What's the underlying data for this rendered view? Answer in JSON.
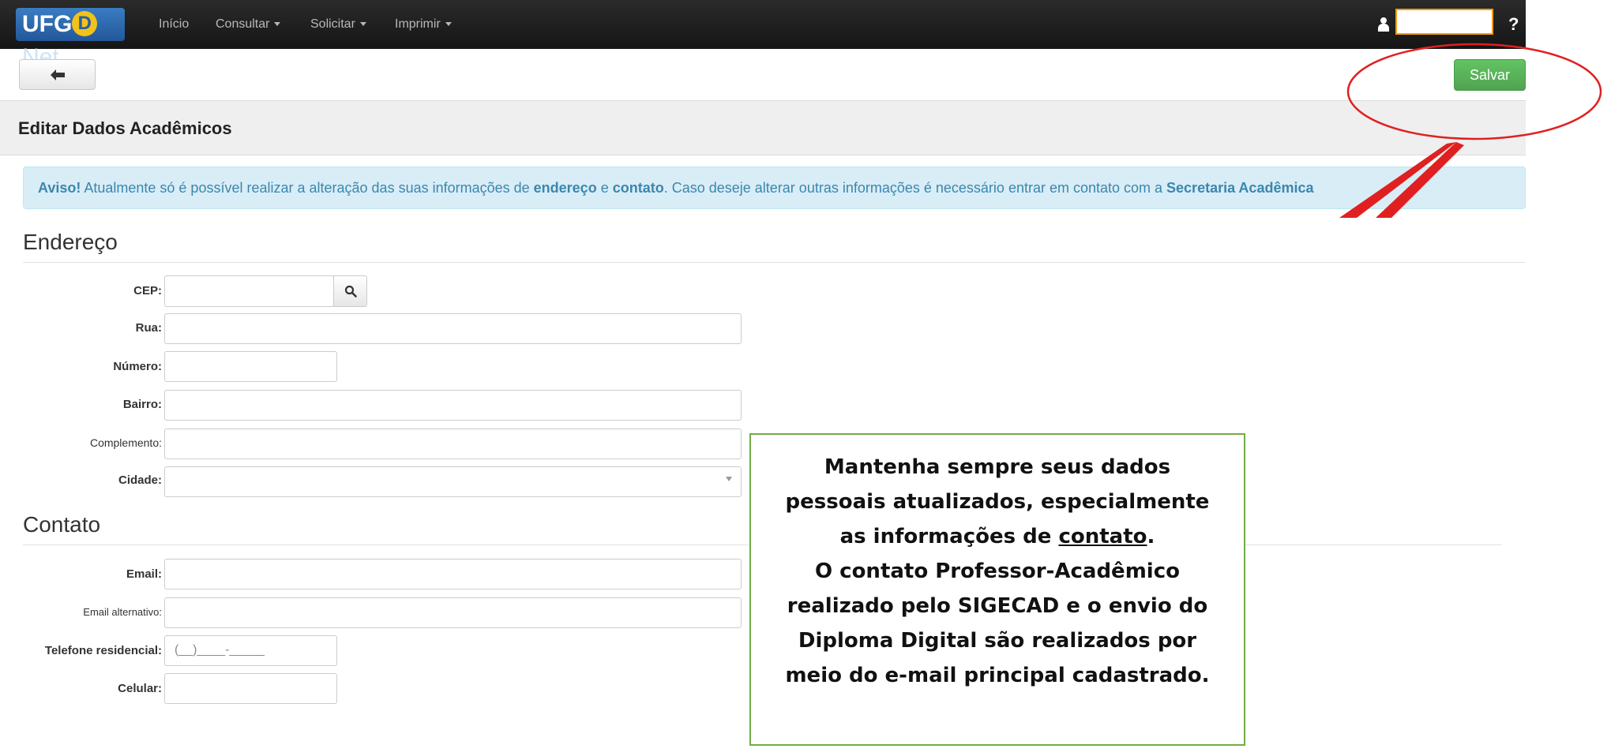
{
  "navbar": {
    "logo_prefix": "UFG",
    "logo_d": "D",
    "logo_suffix": "Net",
    "items": [
      {
        "label": "Início"
      },
      {
        "label": "Consultar"
      },
      {
        "label": "Solicitar"
      },
      {
        "label": "Imprimir"
      }
    ],
    "user_icon": "user-icon",
    "help_label": "?"
  },
  "toolbar": {
    "back_icon": "arrow-left-icon",
    "back_label": "🠔",
    "save_label": "Salvar"
  },
  "page": {
    "title": "Editar Dados Acadêmicos"
  },
  "alert": {
    "strong": "Aviso!",
    "text1": " Atualmente só é possível realizar a alteração das suas informações de ",
    "bold1": "endereço",
    "text2": " e ",
    "bold2": "contato",
    "text3": ". Caso deseje alterar outras informações é necessário entrar em contato com a ",
    "bold3": "Secretaria Acadêmica"
  },
  "endereco": {
    "heading": "Endereço",
    "fields": [
      {
        "label": "CEP:",
        "value": ""
      },
      {
        "label": "Rua:",
        "value": ""
      },
      {
        "label": "Número:",
        "value": ""
      },
      {
        "label": "Bairro:",
        "value": ""
      },
      {
        "label": "Complemento:",
        "value": ""
      },
      {
        "label": "Cidade:",
        "value": ""
      }
    ]
  },
  "contato": {
    "heading": "Contato",
    "fields": [
      {
        "label": "Email:",
        "value": ""
      },
      {
        "label": "Email alternativo:",
        "value": ""
      },
      {
        "label": "Telefone residencial:",
        "value": "(__)____-_____"
      },
      {
        "label": "Celular:",
        "value": ""
      }
    ]
  },
  "note": {
    "line1": "Mantenha sempre seus dados",
    "line2": "pessoais atualizados, especialmente",
    "line3_pre": "as informações de ",
    "line3_u": "contato",
    "line3_post": ".",
    "line4": "O contato Professor-Acadêmico",
    "line5": "realizado pelo SIGECAD e o envio do",
    "line6": "Diploma Digital são realizados por",
    "line7": "meio do e-mail principal cadastrado."
  },
  "colors": {
    "navbar": "#1c1c1c",
    "save_green": "#5bb75b",
    "alert_bg": "#d9edf7",
    "annotation_red": "#e02020",
    "note_border": "#70ad47"
  }
}
